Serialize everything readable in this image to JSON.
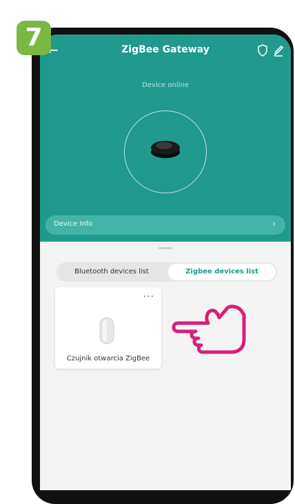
{
  "step": {
    "number": "7",
    "color": "#7ab844"
  },
  "header": {
    "title": "ZigBee Gateway",
    "status": "Device online",
    "device_info_label": "Device Info",
    "color": "#1f9a8c",
    "back_icon": "back-arrow-icon",
    "actions": [
      "shield-icon",
      "edit-icon"
    ]
  },
  "tabs": {
    "bluetooth_label": "Bluetooth devices list",
    "zigbee_label": "Zigbee devices list",
    "selected": "zigbee"
  },
  "devices": [
    {
      "name": "Czujnik otwarcia ZigBee",
      "icon": "door-sensor-icon"
    }
  ],
  "annotation": {
    "pointer_icon": "pointing-hand-icon",
    "color": "#d61f7a"
  }
}
